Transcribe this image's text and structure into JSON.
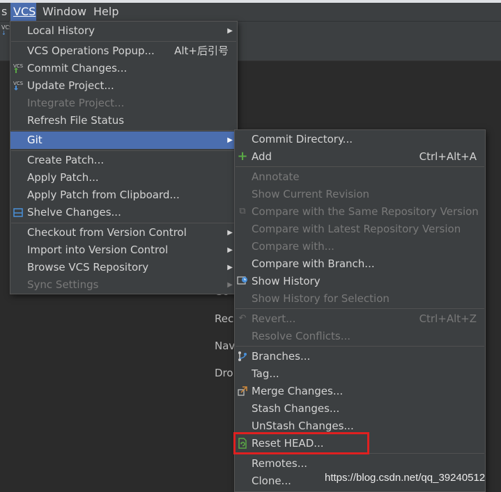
{
  "menubar": {
    "items": [
      "s",
      "VCS",
      "Window",
      "Help"
    ],
    "active": "VCS"
  },
  "editor_hints": [
    "Go",
    "Rec",
    "Nav",
    "Dro"
  ],
  "vcs_menu": {
    "items": [
      {
        "label": "Local History",
        "submenu": true
      },
      {
        "label": "VCS Operations Popup...",
        "shortcut": "Alt+后引号"
      },
      {
        "label": "Commit Changes...",
        "icon": "vcs-commit-icon"
      },
      {
        "label": "Update Project...",
        "icon": "vcs-update-icon"
      },
      {
        "label": "Integrate Project...",
        "disabled": true
      },
      {
        "label": "Refresh File Status"
      },
      {
        "label": "Git",
        "submenu": true,
        "selected": true
      },
      {
        "label": "Create Patch..."
      },
      {
        "label": "Apply Patch..."
      },
      {
        "label": "Apply Patch from Clipboard..."
      },
      {
        "label": "Shelve Changes...",
        "icon": "shelve-icon"
      },
      {
        "label": "Checkout from Version Control",
        "submenu": true
      },
      {
        "label": "Import into Version Control",
        "submenu": true
      },
      {
        "label": "Browse VCS Repository",
        "submenu": true
      },
      {
        "label": "Sync Settings",
        "submenu": true,
        "disabled": true
      }
    ]
  },
  "git_menu": {
    "items": [
      {
        "label": "Commit Directory..."
      },
      {
        "label": "Add",
        "shortcut": "Ctrl+Alt+A",
        "icon": "plus-icon"
      },
      {
        "label": "Annotate",
        "disabled": true
      },
      {
        "label": "Show Current Revision",
        "disabled": true
      },
      {
        "label": "Compare with the Same Repository Version",
        "disabled": true
      },
      {
        "label": "Compare with Latest Repository Version",
        "disabled": true
      },
      {
        "label": "Compare with...",
        "disabled": true
      },
      {
        "label": "Compare with Branch..."
      },
      {
        "label": "Show History",
        "icon": "history-icon"
      },
      {
        "label": "Show History for Selection",
        "disabled": true
      },
      {
        "label": "Revert...",
        "shortcut": "Ctrl+Alt+Z",
        "disabled": true
      },
      {
        "label": "Resolve Conflicts...",
        "disabled": true
      },
      {
        "label": "Branches...",
        "icon": "branch-icon"
      },
      {
        "label": "Tag..."
      },
      {
        "label": "Merge Changes...",
        "icon": "merge-icon"
      },
      {
        "label": "Stash Changes..."
      },
      {
        "label": "UnStash Changes..."
      },
      {
        "label": "Reset HEAD...",
        "icon": "reset-icon"
      },
      {
        "label": "Remotes..."
      },
      {
        "label": "Clone..."
      }
    ]
  },
  "watermark": "https://blog.csdn.net/qq_39240512",
  "colors": {
    "accent": "#4b6eaf",
    "highlight_box": "#e02020",
    "menu_bg": "#3c3f41"
  }
}
